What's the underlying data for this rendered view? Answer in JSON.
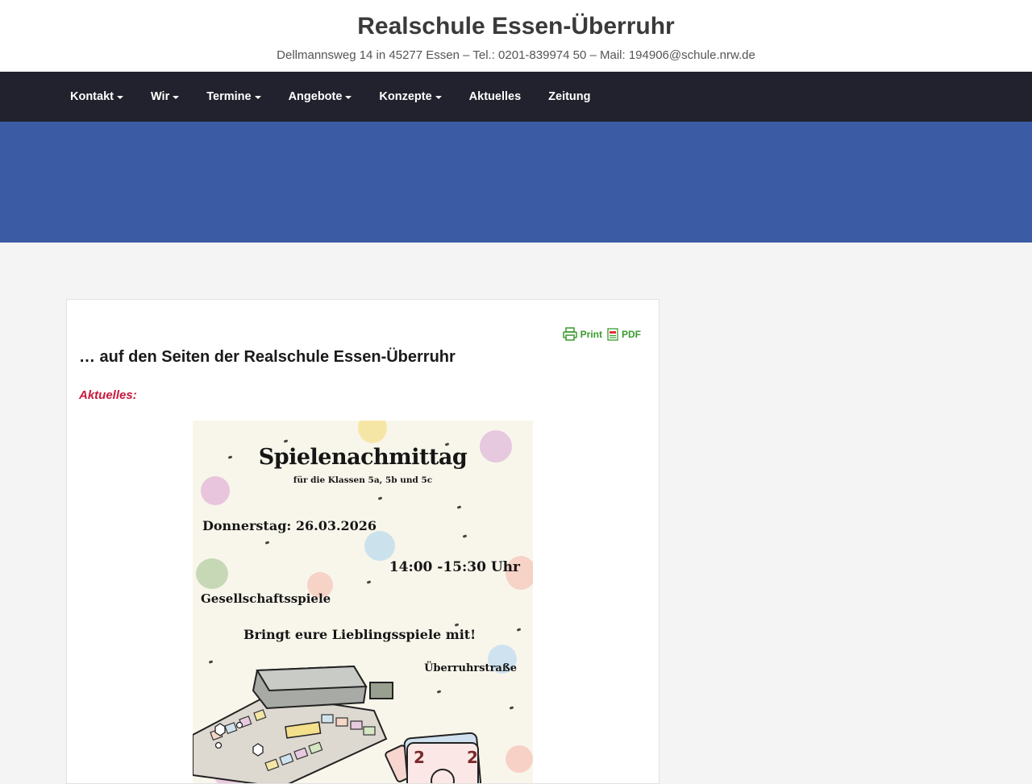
{
  "site": {
    "title": "Realschule Essen-Überruhr",
    "description": "Dellmannsweg 14 in 45277 Essen – Tel.: 0201-839974 50 – Mail: 194906@schule.nrw.de"
  },
  "nav": {
    "items": [
      {
        "label": "Kontakt",
        "dropdown": true
      },
      {
        "label": "Wir",
        "dropdown": true
      },
      {
        "label": "Termine",
        "dropdown": true
      },
      {
        "label": "Angebote",
        "dropdown": true
      },
      {
        "label": "Konzepte",
        "dropdown": true
      },
      {
        "label": "Aktuelles",
        "dropdown": false
      },
      {
        "label": "Zeitung",
        "dropdown": false
      }
    ]
  },
  "colors": {
    "nav_bg": "#22222e",
    "hero_bg": "#3b5ca4",
    "accent_red": "#c8183c",
    "tool_green": "#3a9a2e"
  },
  "tools": {
    "print_label": "Print",
    "pdf_label": "PDF",
    "print_icon": "printer-icon",
    "pdf_icon": "pdf-icon"
  },
  "content": {
    "heading": "… auf den Seiten der Realschule Essen-Überruhr",
    "section_label": "Aktuelles:"
  },
  "poster": {
    "title": "Spielenachmittag",
    "subtitle": "für die Klassen 5a, 5b und 5c",
    "date": "Donnerstag: 26.03.2026",
    "time": "14:00 -15:30 Uhr",
    "games": "Gesellschaftsspiele",
    "bring": "Bringt eure Lieblingsspiele mit!",
    "street": "Überruhrstraße",
    "card_number": "2"
  }
}
